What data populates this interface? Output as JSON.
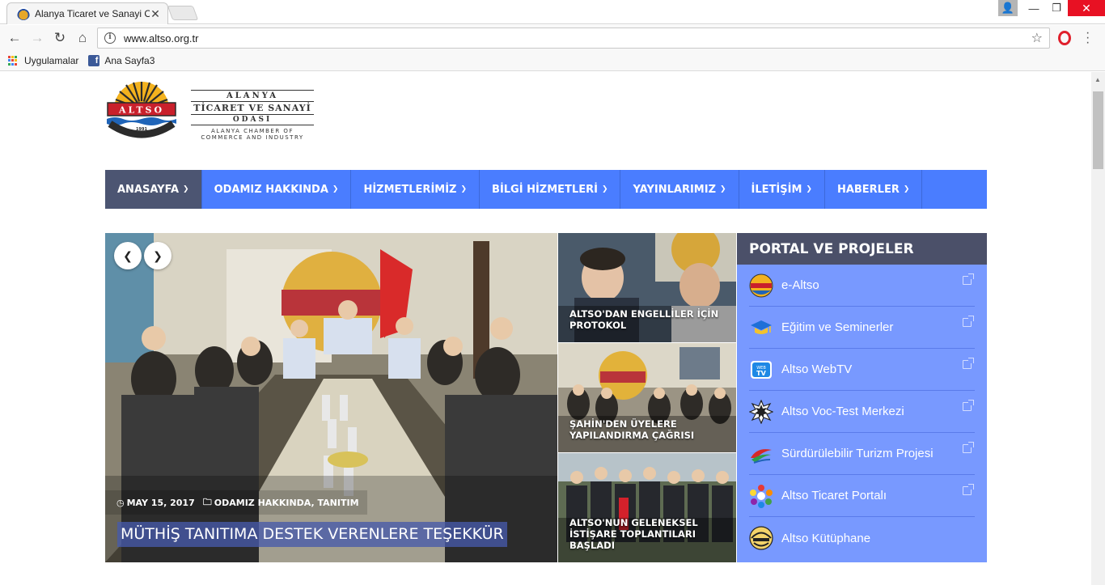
{
  "browser": {
    "tab_title": "Alanya Ticaret ve Sanayi O",
    "url": "www.altso.org.tr",
    "bookmarks": [
      "Uygulamalar",
      "Ana Sayfa3"
    ]
  },
  "logo": {
    "emblem_text": "ALTSO",
    "emblem_year": "1991",
    "line1": "ALANYA",
    "line2": "TİCARET VE SANAYİ",
    "line3": "ODASI",
    "line4": "ALANYA CHAMBER OF",
    "line5": "COMMERCE AND INDUSTRY"
  },
  "nav": {
    "items": [
      "ANASAYFA",
      "ODAMIZ HAKKINDA",
      "HİZMETLERİMİZ",
      "BİLGİ HİZMETLERİ",
      "YAYINLARIMIZ",
      "İLETİŞİM",
      "HABERLER"
    ],
    "active": "ANASAYFA"
  },
  "slider": {
    "date": "MAY 15, 2017",
    "category": "ODAMIZ HAKKINDA, TANITIM",
    "title": "MÜTHİŞ TANITIMA DESTEK VERENLERE TEŞEKKÜR"
  },
  "news": [
    {
      "title": "ALTSO'DAN ENGELLİLER İÇİN PROTOKOL"
    },
    {
      "title": "ŞAHİN'DEN ÜYELERE YAPILANDIRMA ÇAĞRISI"
    },
    {
      "title": "ALTSO'NUN GELENEKSEL İSTİŞARE TOPLANTILARI BAŞLADI"
    }
  ],
  "portal": {
    "heading": "PORTAL VE PROJELER",
    "items": [
      {
        "label": "e-Altso",
        "icon": "altso-emblem-icon",
        "external": true
      },
      {
        "label": "Eğitim ve Seminerler",
        "icon": "graduation-cap-icon",
        "external": true
      },
      {
        "label": "Altso WebTV",
        "icon": "webtv-icon",
        "external": true
      },
      {
        "label": "Altso Voc-Test Merkezi",
        "icon": "voc-test-icon",
        "external": true
      },
      {
        "label": "Sürdürülebilir Turizm Projesi",
        "icon": "sustainable-tourism-icon",
        "external": true
      },
      {
        "label": "Altso Ticaret Portalı",
        "icon": "trade-portal-icon",
        "external": true
      },
      {
        "label": "Altso Kütüphane",
        "icon": "library-icon",
        "external": false
      }
    ]
  },
  "colors": {
    "nav_bg": "#4a7dff",
    "nav_active": "#4c5572",
    "portal_bg": "#7899ff",
    "portal_head": "#4b5069"
  }
}
